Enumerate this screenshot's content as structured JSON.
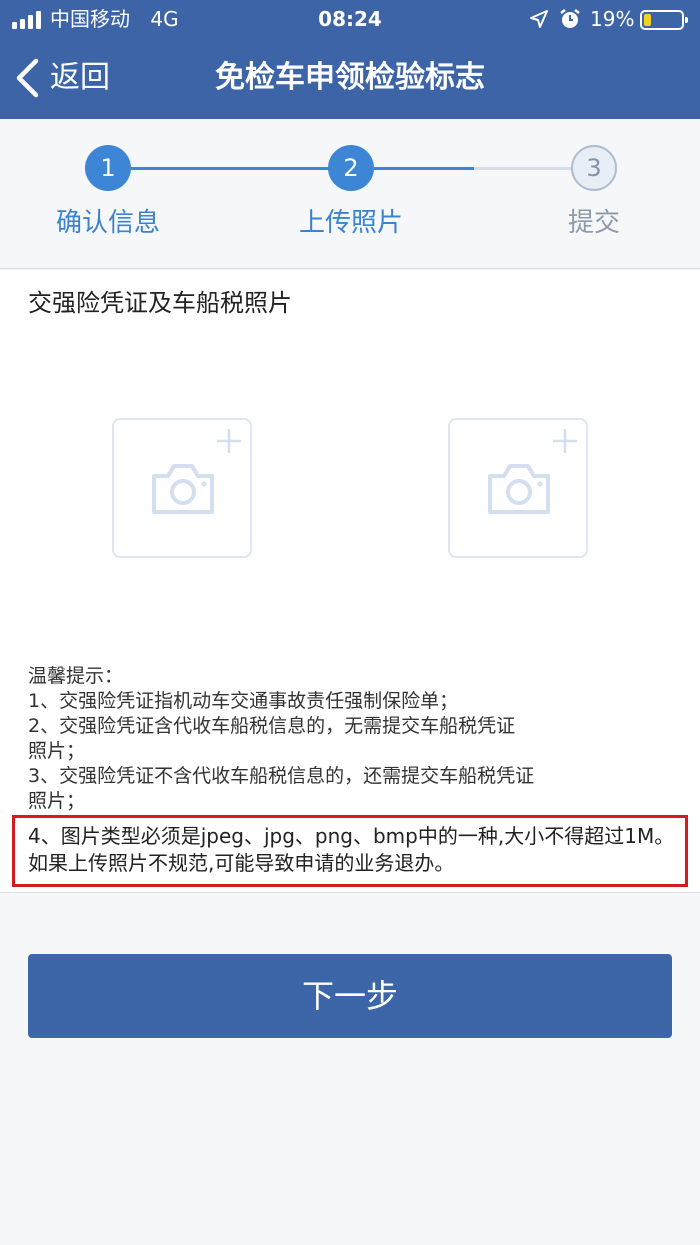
{
  "status_bar": {
    "carrier": "中国移动",
    "network": "4G",
    "time": "08:24",
    "battery_percent": "19%",
    "battery_level": 0.19,
    "battery_color": "#f5d21c"
  },
  "nav": {
    "back_label": "返回",
    "title": "免检车申领检验标志",
    "background_color": "#3c64a6"
  },
  "steps": [
    {
      "number": "1",
      "label": "确认信息",
      "state": "done"
    },
    {
      "number": "2",
      "label": "上传照片",
      "state": "current"
    },
    {
      "number": "3",
      "label": "提交",
      "state": "pending"
    }
  ],
  "content": {
    "section_title": "交强险凭证及车船税照片",
    "upload_slots": [
      {
        "icon": "camera-icon",
        "badge_icon": "plus-icon"
      },
      {
        "icon": "camera-icon",
        "badge_icon": "plus-icon"
      }
    ],
    "tips": {
      "heading": "温馨提示：",
      "lines": [
        "1、交强险凭证指机动车交通事故责任强制保险单；",
        "2、交强险凭证含代收车船税信息的，无需提交车船税凭证",
        "照片；",
        "3、交强险凭证不含代收车船税信息的，还需提交车船税凭证",
        "照片；"
      ],
      "highlighted": "4、图片类型必须是jpeg、jpg、png、bmp中的一种,大小不得超过1M。如果上传照片不规范,可能导致申请的业务退办。",
      "highlight_color": "#d71a20"
    }
  },
  "next_button": {
    "label": "下一步",
    "color": "#3d66a8"
  },
  "colors": {
    "accent": "#3d86d6",
    "page_background": "#f5f7f9"
  }
}
